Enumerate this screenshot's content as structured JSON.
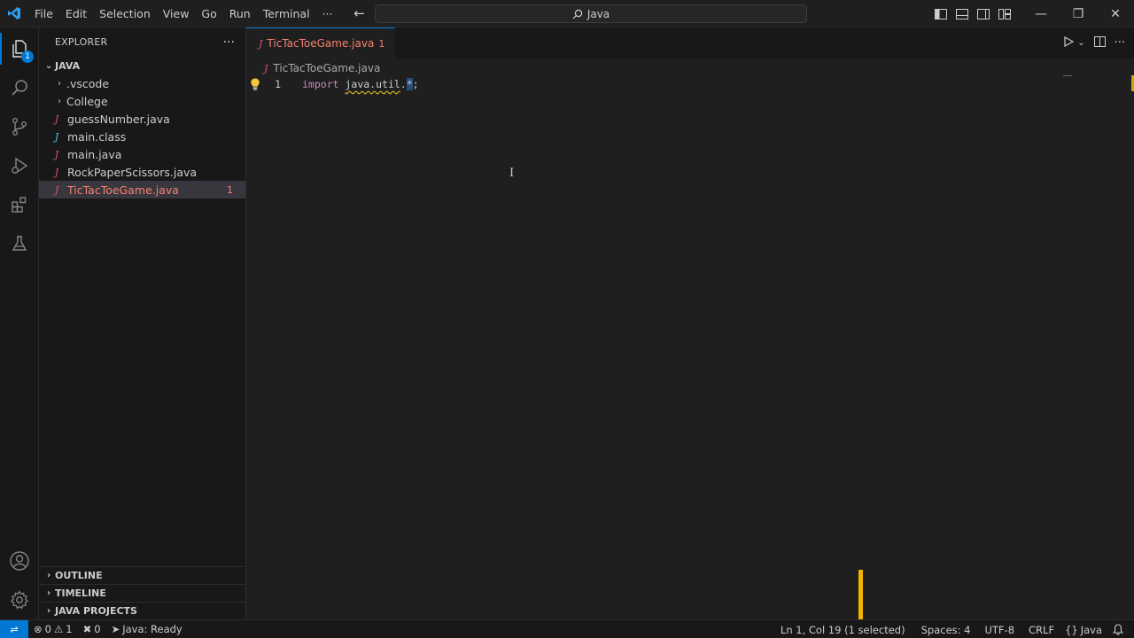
{
  "menu": [
    "File",
    "Edit",
    "Selection",
    "View",
    "Go",
    "Run",
    "Terminal",
    "···"
  ],
  "command_center": {
    "text": "Java",
    "icon": "search-icon"
  },
  "activity": {
    "badge": "1"
  },
  "explorer": {
    "title": "EXPLORER",
    "more": "···",
    "root": "JAVA",
    "items": [
      {
        "label": ".vscode",
        "kind": "folder"
      },
      {
        "label": "College",
        "kind": "folder"
      },
      {
        "label": "guessNumber.java",
        "kind": "java"
      },
      {
        "label": "main.class",
        "kind": "class"
      },
      {
        "label": "main.java",
        "kind": "java"
      },
      {
        "label": "RockPaperScissors.java",
        "kind": "java"
      },
      {
        "label": "TicTacToeGame.java",
        "kind": "java",
        "problems": "1",
        "selected": true
      }
    ],
    "bottom_sections": [
      "OUTLINE",
      "TIMELINE",
      "JAVA PROJECTS"
    ]
  },
  "editor": {
    "tab": {
      "name": "TicTacToeGame.java",
      "problems": "1"
    },
    "breadcrumb": "TicTacToeGame.java",
    "line": {
      "number": "1",
      "keyword": "import",
      "package": "java.util",
      "dot": ".",
      "selected": "*",
      "end": ";"
    }
  },
  "status": {
    "errors": "0",
    "warnings": "1",
    "ports": "0",
    "java_status": "Java: Ready",
    "cursor": "Ln 1, Col 19 (1 selected)",
    "spaces": "Spaces: 4",
    "encoding": "UTF-8",
    "eol": "CRLF",
    "language": "Java"
  },
  "colors": {
    "accent": "#0078d4",
    "error": "#f88070",
    "java_icon": "#e44d71",
    "highlight": "#f2b400"
  }
}
